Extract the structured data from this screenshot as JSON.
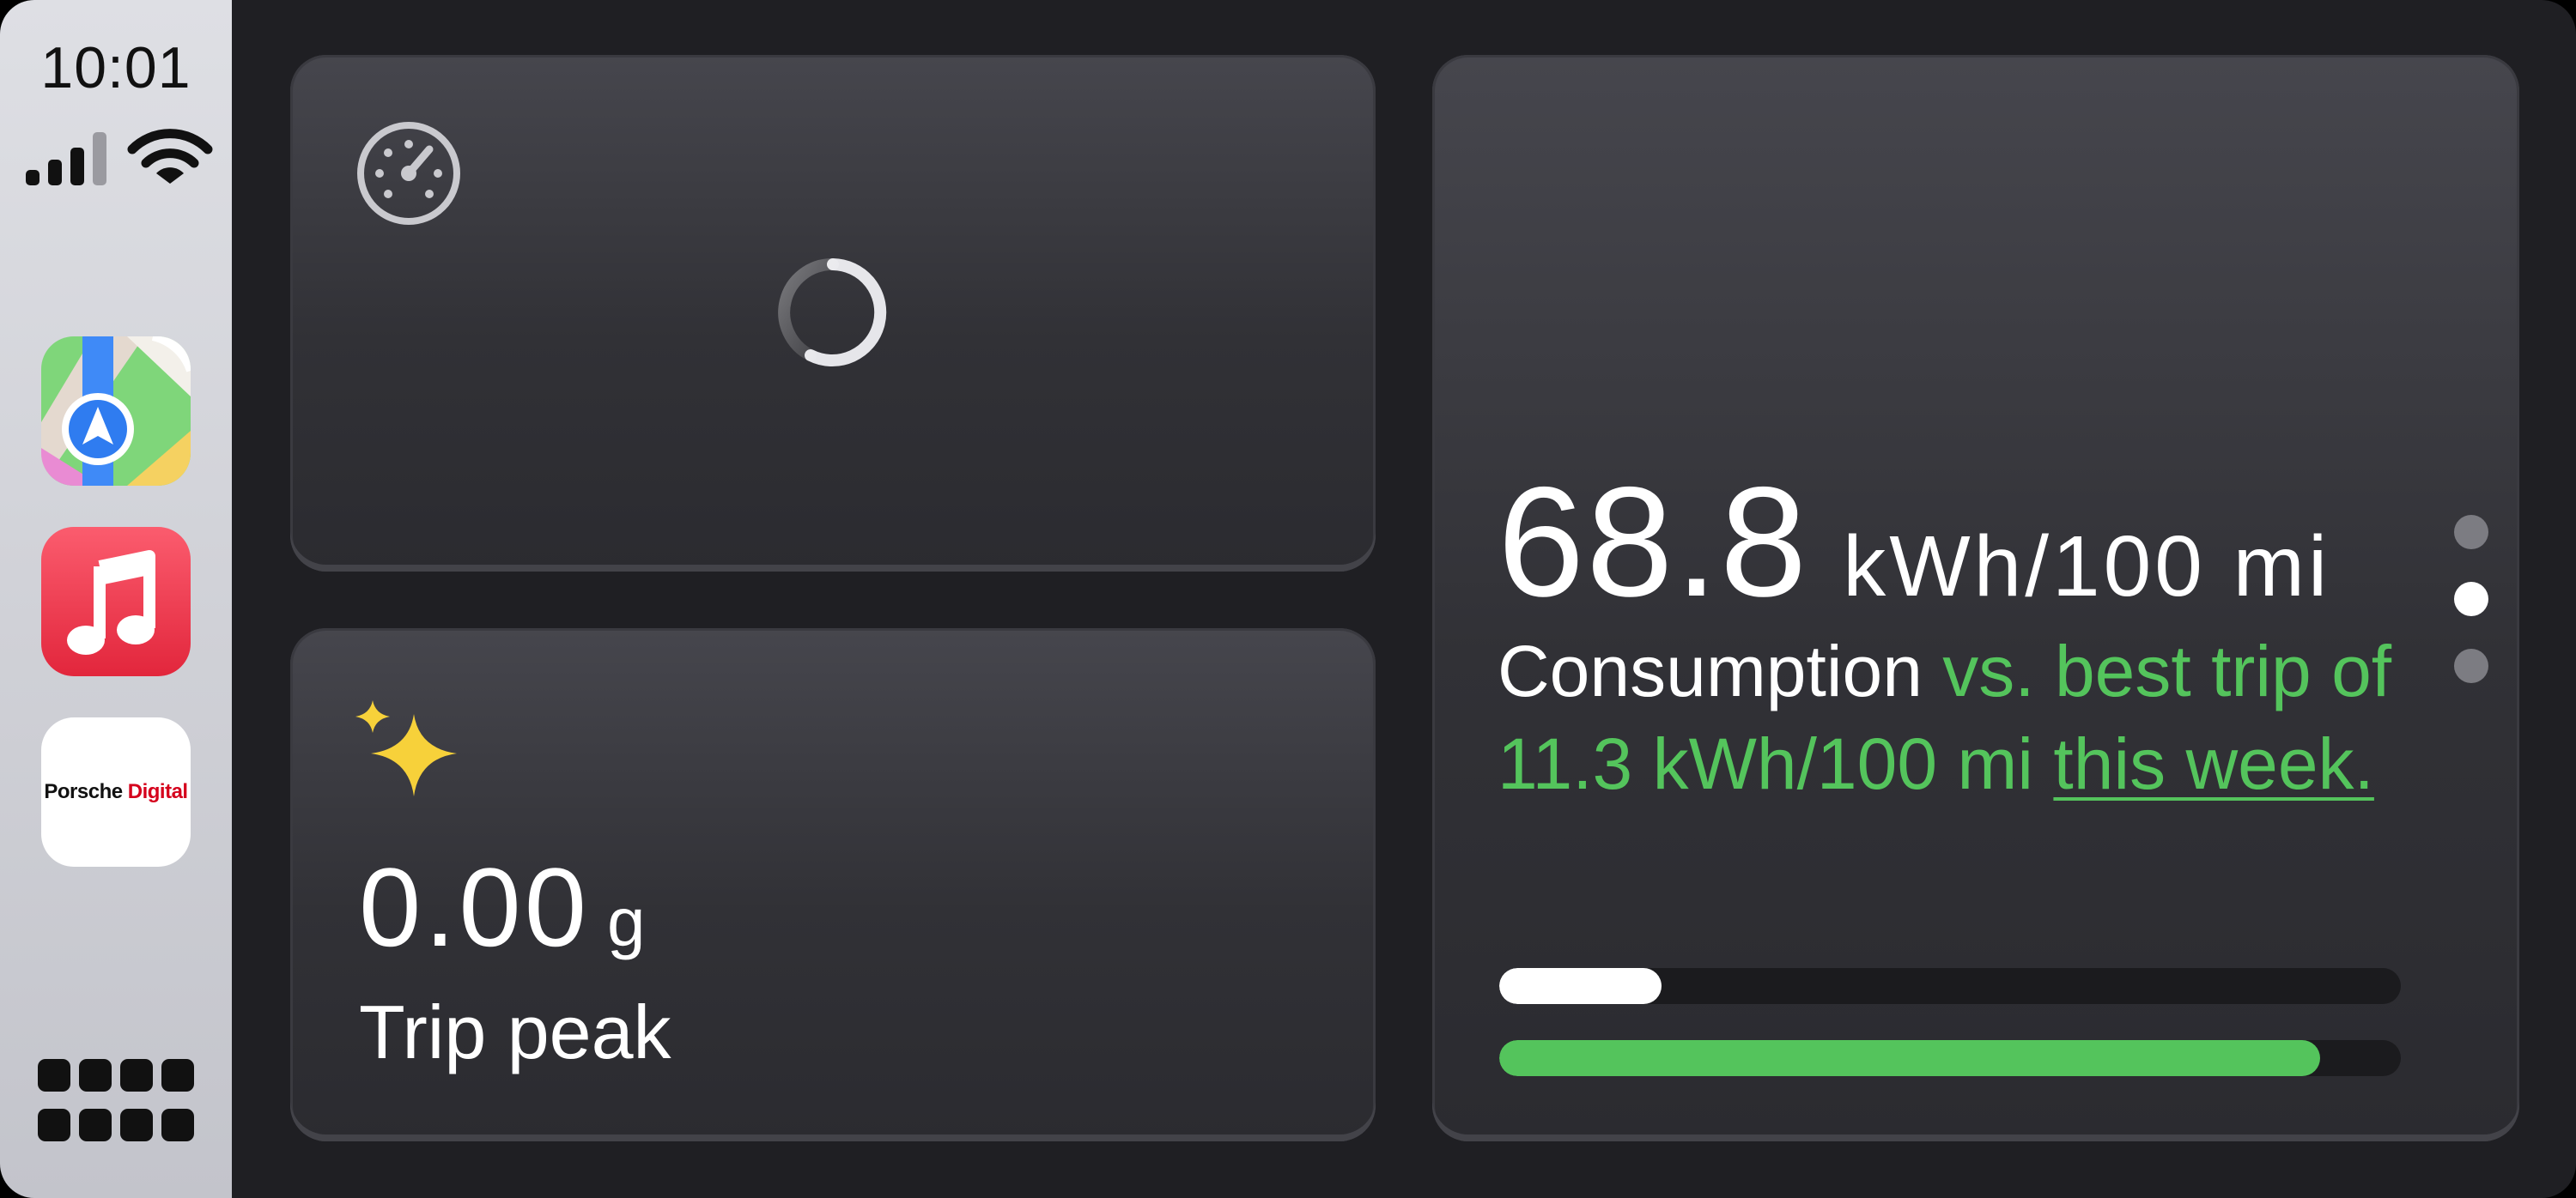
{
  "status_bar": {
    "time": "10:01",
    "icons": [
      "cellular-signal-icon",
      "wifi-icon"
    ]
  },
  "dock": {
    "apps": [
      {
        "name": "Maps",
        "icon": "maps-icon"
      },
      {
        "name": "Music",
        "icon": "music-icon"
      },
      {
        "name": "Porsche Digital",
        "icon": "porsche-digital-icon",
        "logo_text_1": "Porsche",
        "logo_text_2": "Digital"
      }
    ],
    "app_grid_icon": "app-grid-icon"
  },
  "widgets": {
    "speed": {
      "icon": "speedometer-icon",
      "state": "loading"
    },
    "gforce": {
      "icon": "sparkles-icon",
      "value": "0.00",
      "unit": "g",
      "label": "Trip peak"
    },
    "consumption": {
      "value": "68.8",
      "unit": "kWh/100 mi",
      "label": "Consumption",
      "comparison_text": "vs. best trip of 11.3 kWh/100 mi",
      "comparison_link": "this week.",
      "current_bar_fraction": 0.18,
      "best_bar_fraction": 0.91,
      "page_count": 3,
      "active_page": 2
    }
  },
  "colors": {
    "background": "#1f1f23",
    "card": "#333338",
    "accent_green": "#54c45c",
    "sidebar": "#d2d3d8",
    "text": "#ffffff"
  }
}
